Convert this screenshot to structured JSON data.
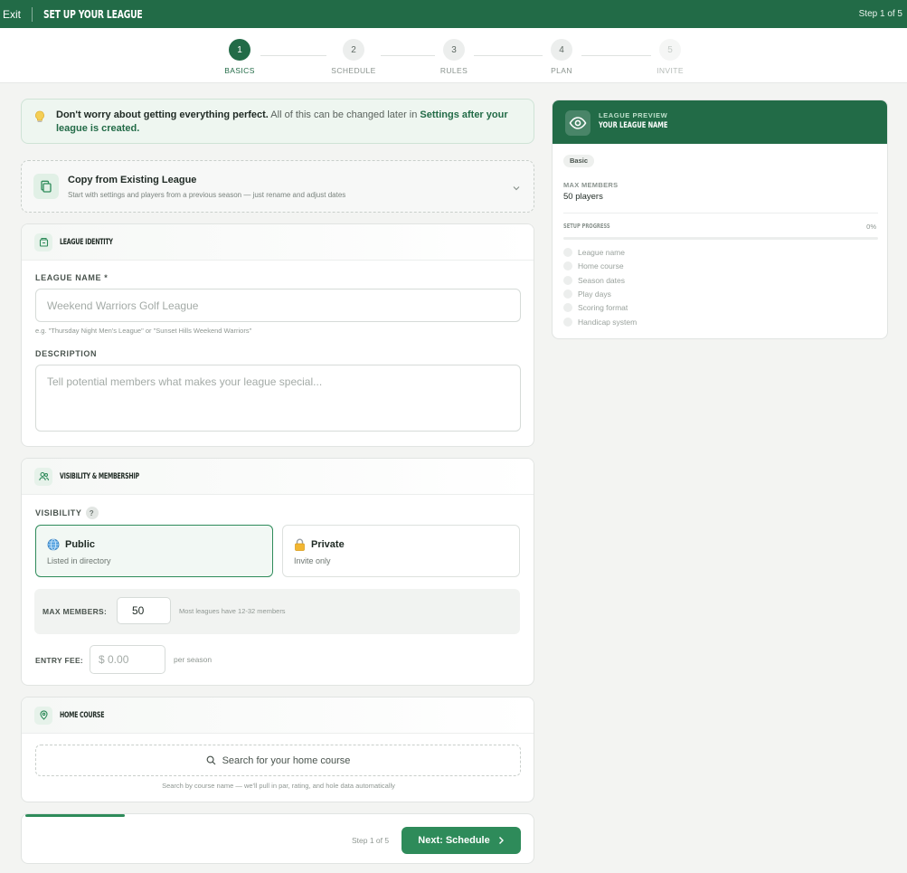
{
  "topbar": {
    "exit_label": "Exit",
    "title": "SET UP YOUR LEAGUE",
    "step_count": "Step 1 of 5"
  },
  "stepper": {
    "steps": [
      {
        "number": "1",
        "label": "BASICS",
        "state": "active"
      },
      {
        "number": "2",
        "label": "SCHEDULE",
        "state": "pending"
      },
      {
        "number": "3",
        "label": "RULES",
        "state": "pending"
      },
      {
        "number": "4",
        "label": "PLAN",
        "state": "pending"
      },
      {
        "number": "5",
        "label": "INVITE",
        "state": "disabled"
      }
    ]
  },
  "tip": {
    "icon": "lightbulb-icon",
    "bold_lead": "Don't worry about getting everything perfect.",
    "body": " All of this can be changed later in ",
    "link": "Settings after your league is created."
  },
  "copy_league": {
    "title": "Copy from Existing League",
    "subtitle": "Start with settings and players from a previous season — just rename and adjust dates",
    "icon": "copy-icon"
  },
  "league_identity": {
    "section_title": "LEAGUE IDENTITY",
    "name_label": "LEAGUE NAME *",
    "name_placeholder": "Weekend Warriors Golf League",
    "name_hint": "e.g. \"Thursday Night Men's League\" or \"Sunset Hills Weekend Warriors\"",
    "description_label": "DESCRIPTION",
    "description_placeholder": "Tell potential members what makes your league special..."
  },
  "visibility": {
    "section_title": "VISIBILITY & MEMBERSHIP",
    "visibility_label": "VISIBILITY",
    "help_mark": "?",
    "options": [
      {
        "title": "Public",
        "subtitle": "Listed in directory",
        "icon": "globe-icon",
        "selected": true
      },
      {
        "title": "Private",
        "subtitle": "Invite only",
        "icon": "lock-icon",
        "selected": false
      }
    ],
    "max_members_label": "MAX MEMBERS:",
    "max_members_value": "50",
    "max_members_hint": "Most leagues have 12-32 members",
    "entry_fee_label": "ENTRY FEE:",
    "entry_fee_placeholder": "$ 0.00",
    "entry_fee_suffix": "per season"
  },
  "home_course": {
    "section_title": "HOME COURSE",
    "search_label": "Search for your home course",
    "search_hint": "Search by course name — we'll pull in par, rating, and hole data automatically"
  },
  "footer": {
    "step_text": "Step 1 of 5",
    "next_label": "Next: Schedule",
    "progress": 0.2
  },
  "preview": {
    "kicker": "LEAGUE PREVIEW",
    "league_name": "YOUR LEAGUE NAME",
    "badge": "Basic",
    "max_members_label": "MAX MEMBERS",
    "max_members_value": "50 players",
    "setup_progress_label": "SETUP PROGRESS",
    "setup_progress_value": "0%",
    "progress": 0,
    "checklist": [
      "League name",
      "Home course",
      "Season dates",
      "Play days",
      "Scoring format",
      "Handicap system"
    ]
  },
  "colors": {
    "brand": "#226b47",
    "accent": "#2e8b5a",
    "tip_bg": "#eef6f0"
  }
}
